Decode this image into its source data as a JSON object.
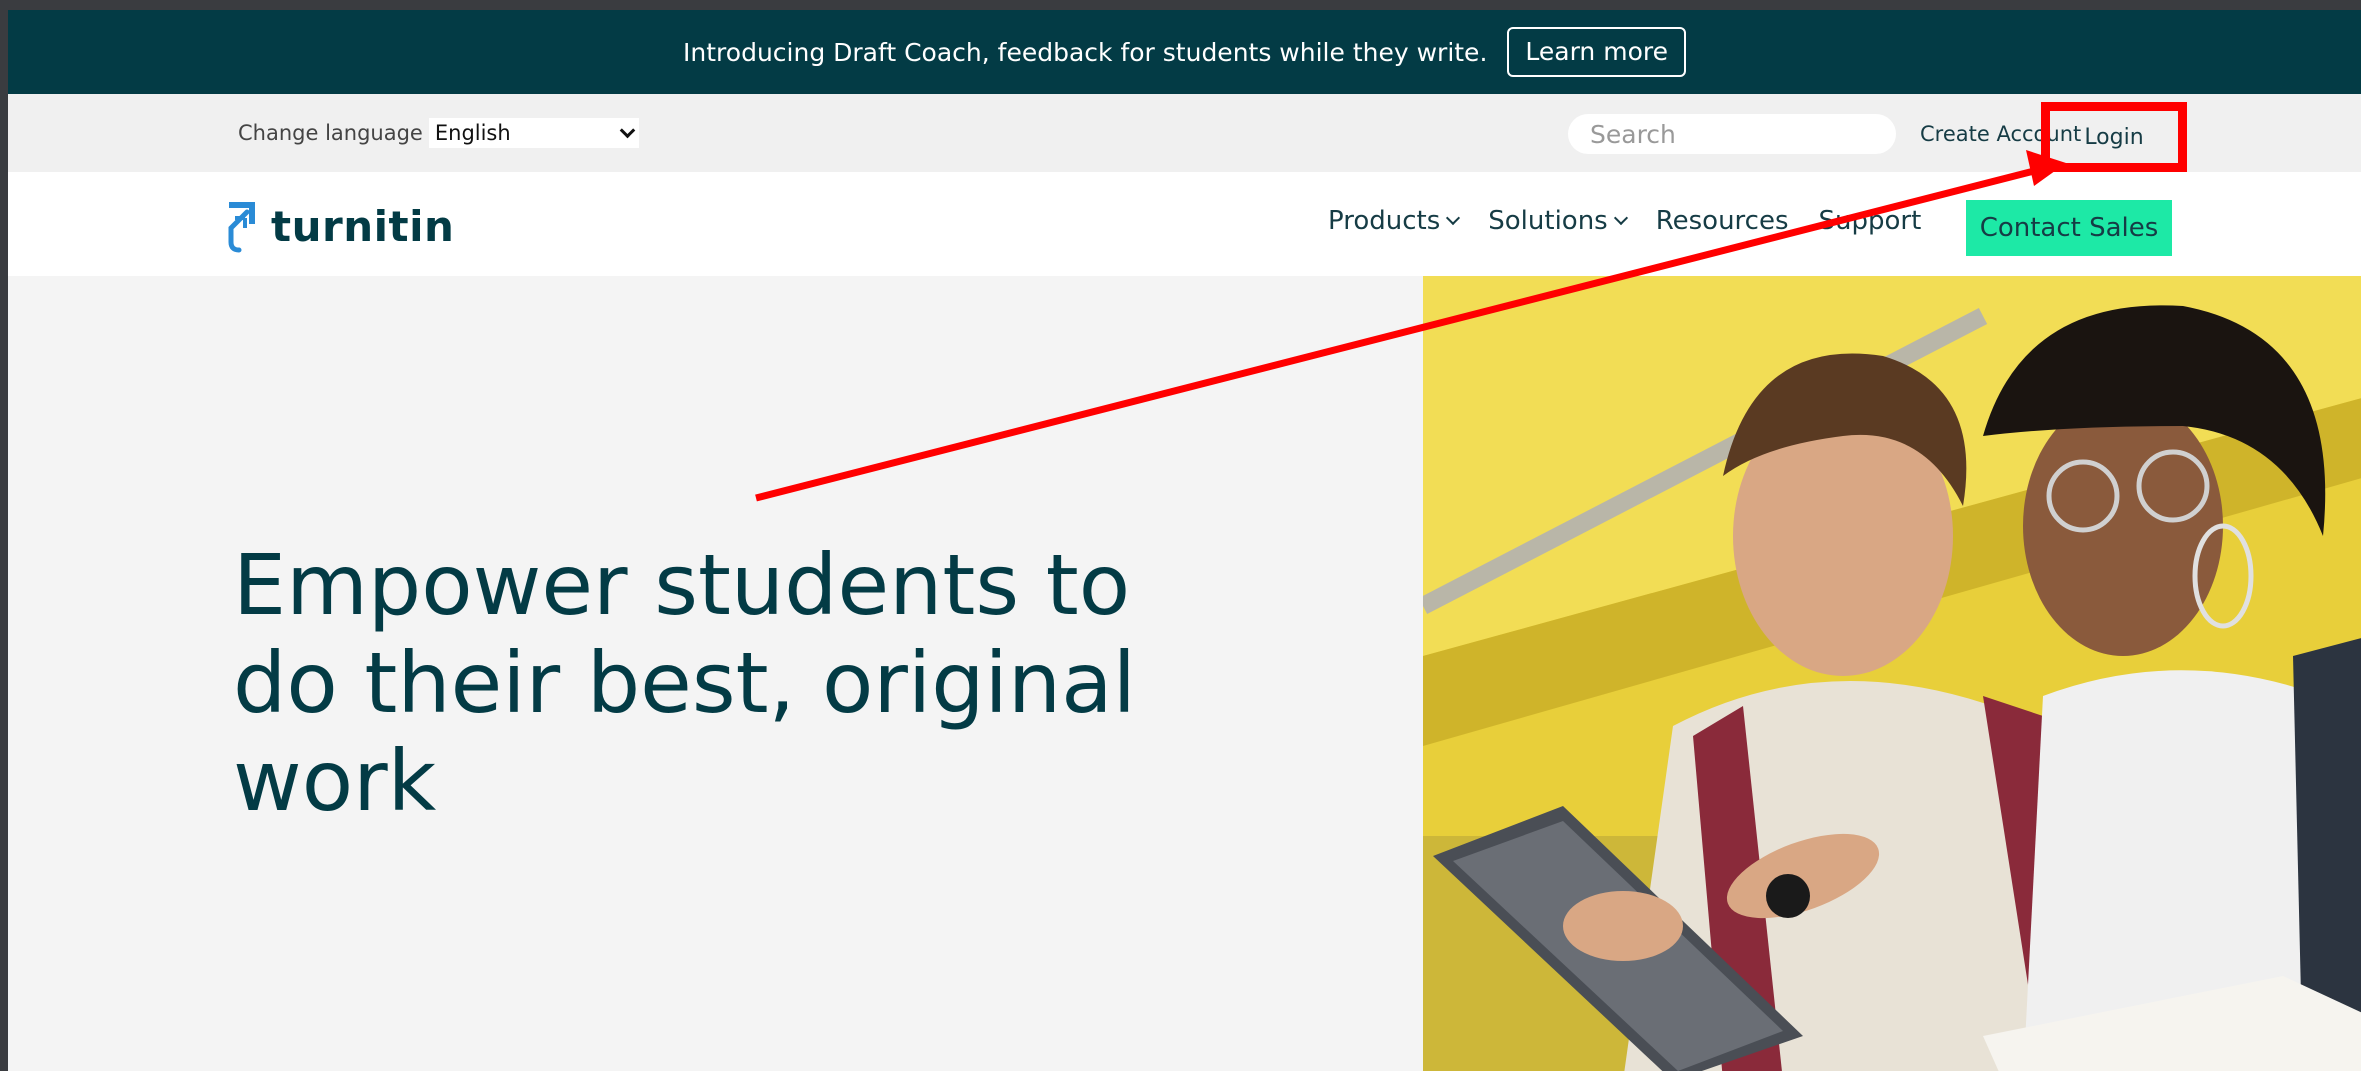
{
  "banner": {
    "text": "Introducing Draft Coach, feedback for students while they write.",
    "button": "Learn more"
  },
  "utility": {
    "change_language_label": "Change language",
    "language_selected": "English",
    "search_placeholder": "Search",
    "create_account": "Create Account",
    "login": "Login"
  },
  "nav": {
    "logo_text": "turnitin",
    "items": [
      "Products",
      "Solutions",
      "Resources",
      "Support"
    ],
    "contact_button": "Contact Sales"
  },
  "hero": {
    "title": "Empower students to do their best, original work"
  },
  "colors": {
    "brand_dark": "#033b45",
    "accent": "#1de9a6",
    "annotation": "#ff0000"
  }
}
